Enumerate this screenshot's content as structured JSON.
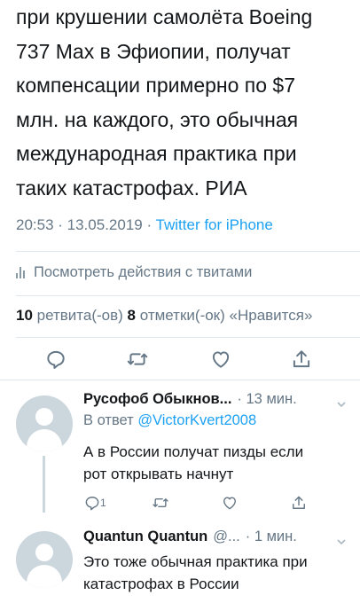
{
  "tweet": {
    "text_lines": [
      "при крушении самолёта Boeing",
      "737 Max в Эфиопии, получат",
      "компенсации примерно по $7",
      "млн. на каждого, это обычная",
      "международная практика при",
      "таких катастрофах. РИА"
    ],
    "time": "20:53 · 13.05.2019 · ",
    "source": "Twitter for iPhone",
    "activity_label": "Посмотреть действия с твитами",
    "retweet_count": "10",
    "retweet_label": " ретвита(-ов) ",
    "like_count": "8",
    "like_label": " отметки(-ок) «Нравится»"
  },
  "replies": [
    {
      "name": "Русофоб Обыкнов...",
      "time": "· 13 мин.",
      "reply_prefix": "В ответ ",
      "reply_to": "@VictorKvert2008",
      "text_lines": [
        "А в России получат пизды если",
        "рот открывать начнут"
      ],
      "reply_count": "1"
    },
    {
      "name": "Quantun Quantun",
      "handle": "@...",
      "time": "· 1 мин.",
      "text_lines": [
        "Это тоже обычная практика при",
        "катастрофах в России"
      ]
    }
  ],
  "icons": {
    "reply": "reply-icon",
    "retweet": "retweet-icon",
    "like": "heart-icon",
    "share": "share-icon",
    "activity": "bar-chart-icon",
    "menu": "chevron-down-icon"
  },
  "colors": {
    "link": "#1da1f2",
    "muted": "#657786",
    "text": "#14171a",
    "divider": "#e1e8ed"
  }
}
